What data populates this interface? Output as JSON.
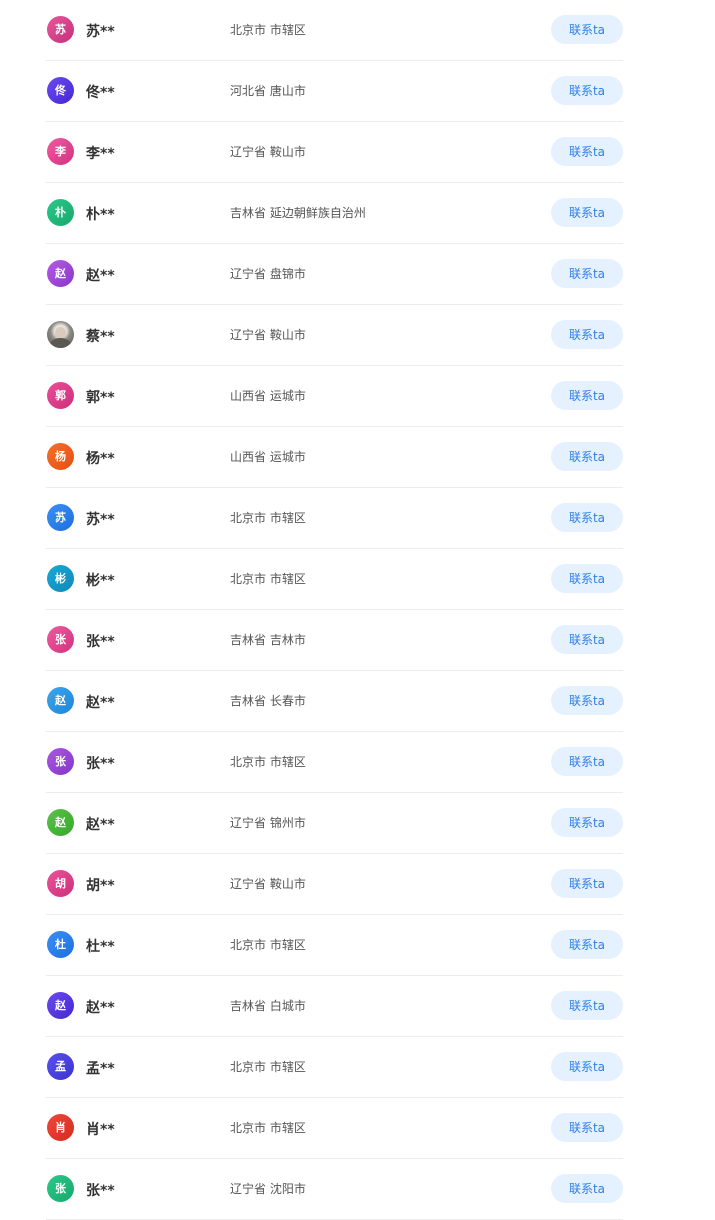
{
  "contact_label": "联系ta",
  "rows": [
    {
      "avatar": "苏",
      "name": "苏**",
      "region": "北京市 市辖区",
      "color1": "#e8579a",
      "color2": "#c52f7b"
    },
    {
      "avatar": "佟",
      "name": "佟**",
      "region": "河北省 唐山市",
      "color1": "#6a4cf0",
      "color2": "#4526d3"
    },
    {
      "avatar": "李",
      "name": "李**",
      "region": "辽宁省 鞍山市",
      "color1": "#ef5aa0",
      "color2": "#d2337f"
    },
    {
      "avatar": "朴",
      "name": "朴**",
      "region": "吉林省 延边朝鲜族自治州",
      "color1": "#2cc98a",
      "color2": "#17a86b"
    },
    {
      "avatar": "赵",
      "name": "赵**",
      "region": "辽宁省 盘锦市",
      "color1": "#b45ce8",
      "color2": "#8a35c9"
    },
    {
      "avatar": "",
      "name": "蔡**",
      "region": "辽宁省 鞍山市",
      "photo": true
    },
    {
      "avatar": "郭",
      "name": "郭**",
      "region": "山西省 运城市",
      "color1": "#ec4f9a",
      "color2": "#cc2f7a"
    },
    {
      "avatar": "杨",
      "name": "杨**",
      "region": "山西省 运城市",
      "color1": "#f5702c",
      "color2": "#e44f12"
    },
    {
      "avatar": "苏",
      "name": "苏**",
      "region": "北京市 市辖区",
      "color1": "#3a8ff5",
      "color2": "#1f6fe0"
    },
    {
      "avatar": "彬",
      "name": "彬**",
      "region": "北京市 市辖区",
      "color1": "#1aa9d6",
      "color2": "#0e88b8"
    },
    {
      "avatar": "张",
      "name": "张**",
      "region": "吉林省 吉林市",
      "color1": "#ef5aa0",
      "color2": "#d2337f"
    },
    {
      "avatar": "赵",
      "name": "赵**",
      "region": "吉林省 长春市",
      "color1": "#3aa6f0",
      "color2": "#1f86d6"
    },
    {
      "avatar": "张",
      "name": "张**",
      "region": "北京市 市辖区",
      "color1": "#a957e6",
      "color2": "#8436c6"
    },
    {
      "avatar": "赵",
      "name": "赵**",
      "region": "辽宁省 锦州市",
      "color1": "#58c548",
      "color2": "#37a62a"
    },
    {
      "avatar": "胡",
      "name": "胡**",
      "region": "辽宁省 鞍山市",
      "color1": "#ec5299",
      "color2": "#cc3079"
    },
    {
      "avatar": "杜",
      "name": "杜**",
      "region": "北京市 市辖区",
      "color1": "#3b8ff5",
      "color2": "#1e6fe0"
    },
    {
      "avatar": "赵",
      "name": "赵**",
      "region": "吉林省 白城市",
      "color1": "#6a4cf0",
      "color2": "#4526d3"
    },
    {
      "avatar": "孟",
      "name": "孟**",
      "region": "北京市 市辖区",
      "color1": "#5a52ec",
      "color2": "#3a32cf"
    },
    {
      "avatar": "肖",
      "name": "肖**",
      "region": "北京市 市辖区",
      "color1": "#f0483a",
      "color2": "#d42b1e"
    },
    {
      "avatar": "张",
      "name": "张**",
      "region": "辽宁省 沈阳市",
      "color1": "#2cc98a",
      "color2": "#17a86b"
    }
  ]
}
